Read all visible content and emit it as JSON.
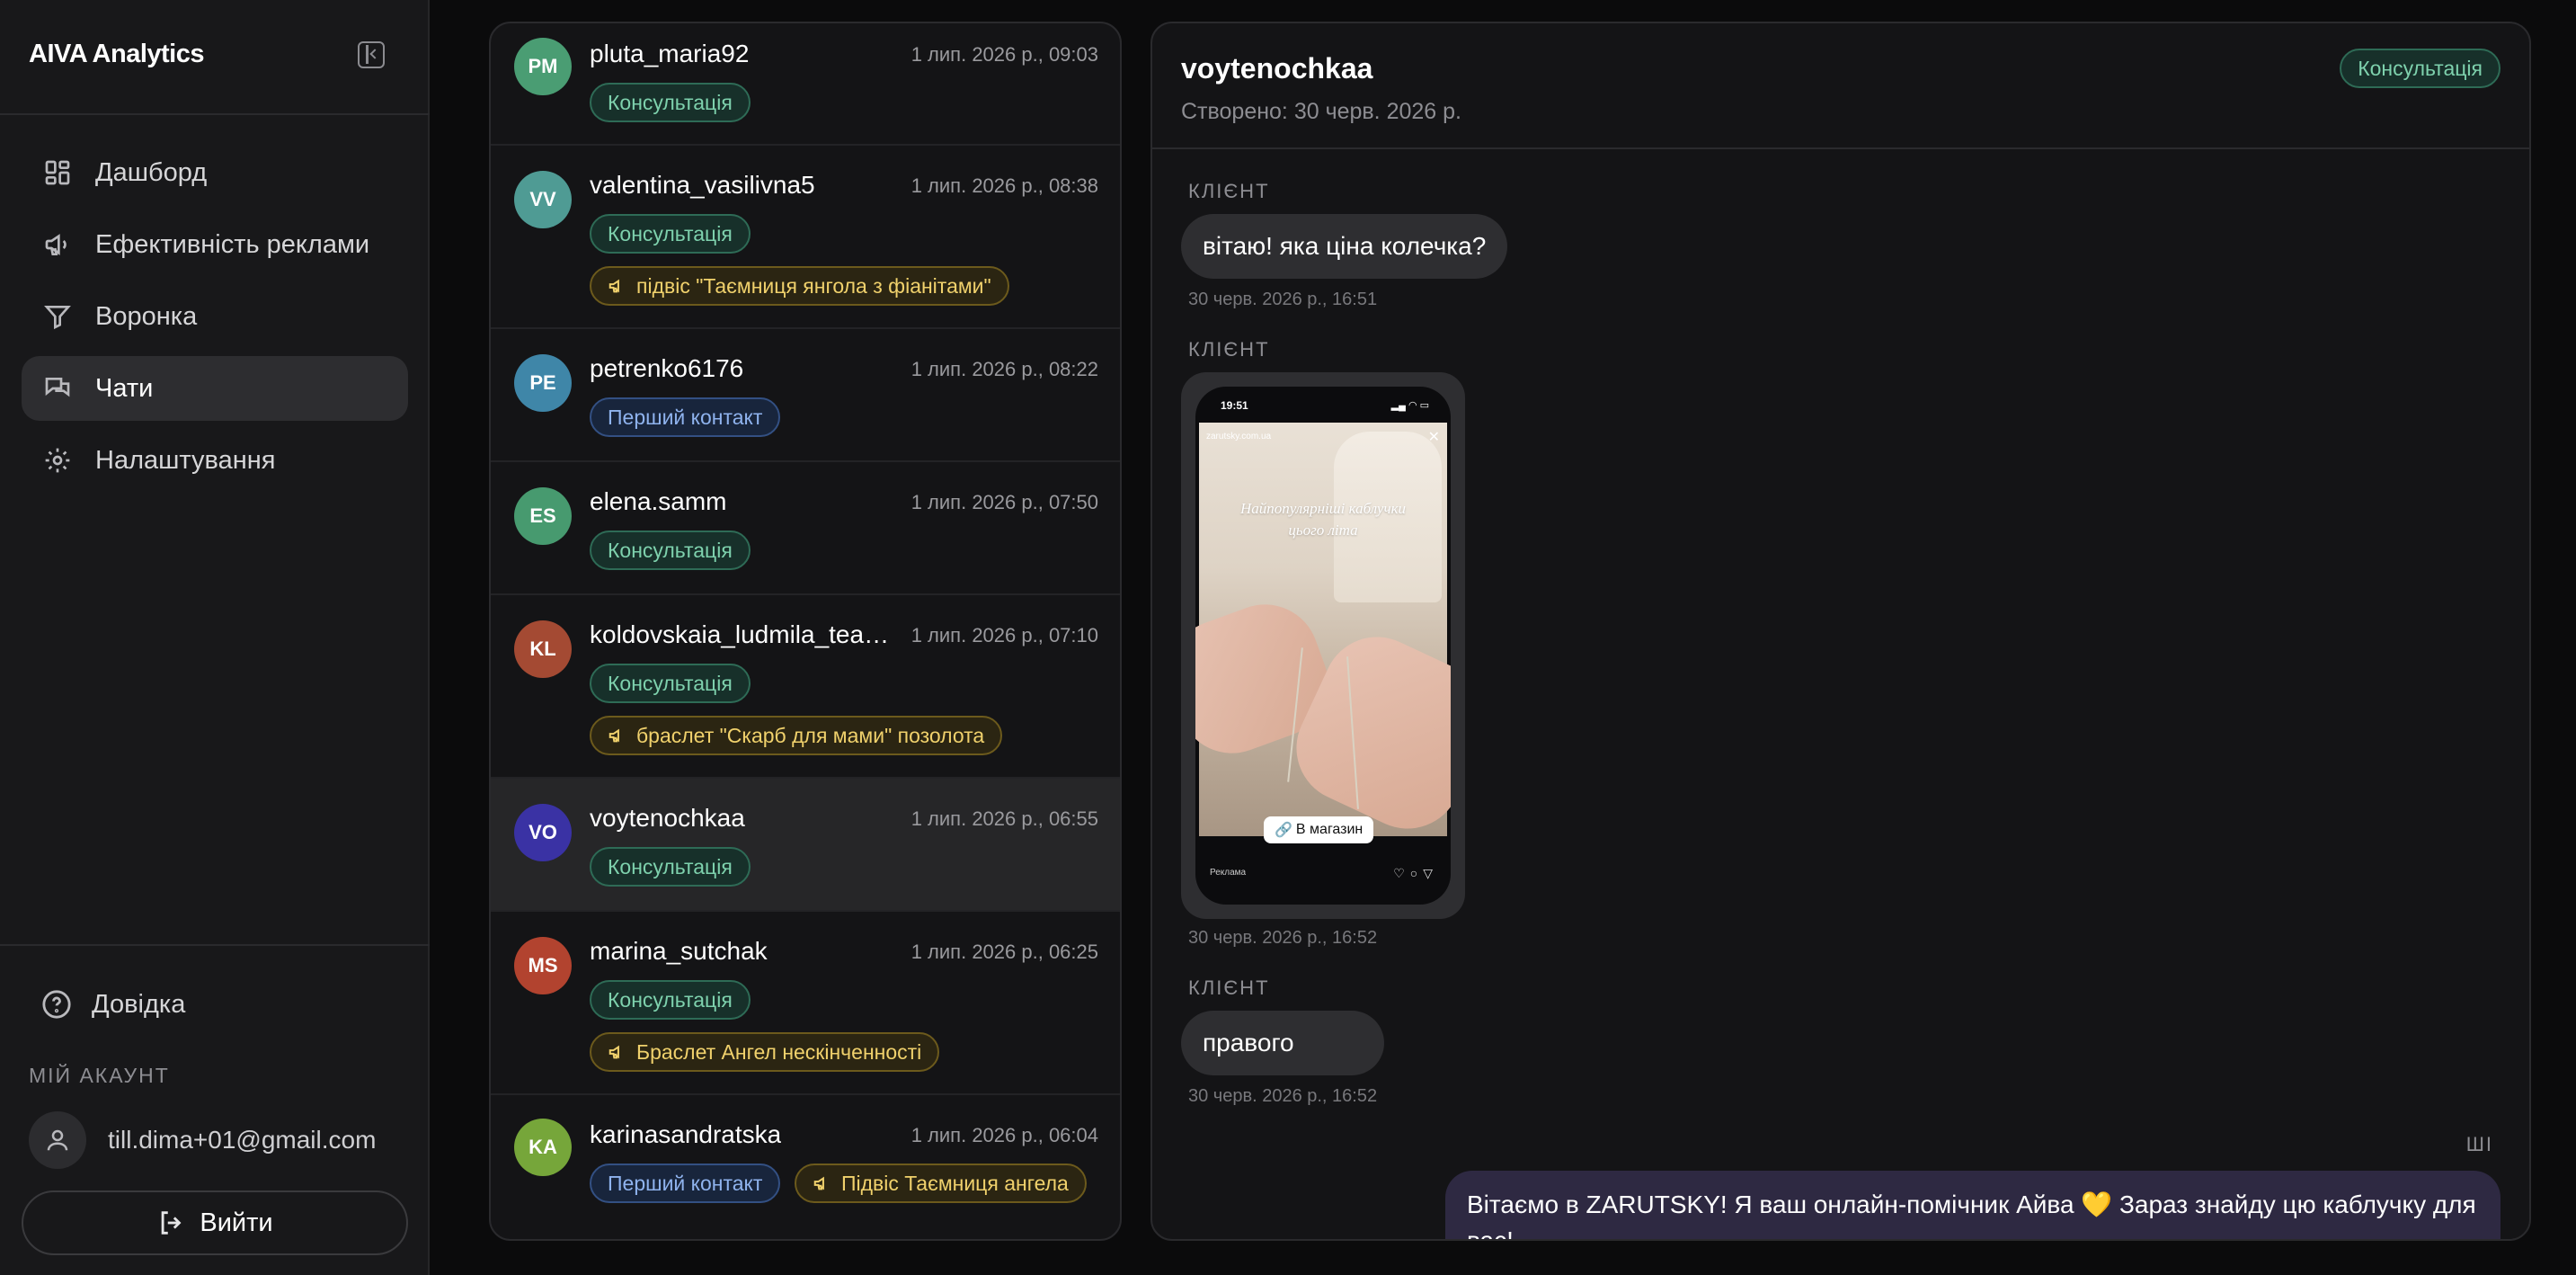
{
  "sidebar": {
    "brand": "AIVA Analytics",
    "nav": [
      {
        "label": "Дашборд",
        "icon": "dashboard-icon"
      },
      {
        "label": "Ефективність реклами",
        "icon": "megaphone-icon"
      },
      {
        "label": "Воронка",
        "icon": "funnel-icon"
      },
      {
        "label": "Чати",
        "icon": "chat-icon",
        "active": true
      },
      {
        "label": "Налаштування",
        "icon": "gear-icon"
      }
    ],
    "help_label": "Довідка",
    "account_label": "МІЙ АКАУНТ",
    "email": "till.dima+01@gmail.com",
    "logout_label": "Вийти"
  },
  "chats": [
    {
      "initials": "PM",
      "name": "pluta_maria92",
      "time": "1 лип. 2026 р., 09:03",
      "avatar_color": "#4a9d73",
      "tags": [
        {
          "kind": "green",
          "text": "Консультація"
        }
      ]
    },
    {
      "initials": "VV",
      "name": "valentina_vasilivna5",
      "time": "1 лип. 2026 р., 08:38",
      "avatar_color": "#4f9b94",
      "tags": [
        {
          "kind": "green",
          "text": "Консультація"
        },
        {
          "kind": "yellow",
          "text": "підвіс \"Таємниця янгола з фіанітами\""
        }
      ]
    },
    {
      "initials": "PE",
      "name": "petrenko6176",
      "time": "1 лип. 2026 р., 08:22",
      "avatar_color": "#3f86a8",
      "tags": [
        {
          "kind": "blue",
          "text": "Перший контакт"
        }
      ]
    },
    {
      "initials": "ES",
      "name": "elena.samm",
      "time": "1 лип. 2026 р., 07:50",
      "avatar_color": "#479a6f",
      "tags": [
        {
          "kind": "green",
          "text": "Консультація"
        }
      ]
    },
    {
      "initials": "KL",
      "name": "koldovskaia_ludmila_teac...",
      "time": "1 лип. 2026 р., 07:10",
      "avatar_color": "#a44a33",
      "tags": [
        {
          "kind": "green",
          "text": "Консультація"
        },
        {
          "kind": "yellow",
          "text": "браслет \"Скарб для мами\" позолота"
        }
      ]
    },
    {
      "initials": "VO",
      "name": "voytenochkaa",
      "time": "1 лип. 2026 р., 06:55",
      "avatar_color": "#3a32a4",
      "selected": true,
      "tags": [
        {
          "kind": "green",
          "text": "Консультація"
        }
      ]
    },
    {
      "initials": "MS",
      "name": "marina_sutchak",
      "time": "1 лип. 2026 р., 06:25",
      "avatar_color": "#b2432f",
      "tags": [
        {
          "kind": "green",
          "text": "Консультація"
        },
        {
          "kind": "yellow",
          "text": "Браслет Ангел нескінченності"
        }
      ]
    },
    {
      "initials": "KA",
      "name": "karinasandratska",
      "time": "1 лип. 2026 р., 06:04",
      "avatar_color": "#76a63a",
      "tags": [
        {
          "kind": "blue",
          "text": "Перший контакт"
        },
        {
          "kind": "yellow",
          "text": "Підвіс Таємниця ангела"
        }
      ]
    }
  ],
  "conversation": {
    "title": "voytenochkaa",
    "created": "Створено: 30 черв. 2026 р.",
    "tag": "Консультація",
    "messages": [
      {
        "role": "КЛІЄНТ",
        "text": "вітаю! яка ціна колечка?",
        "time": "30 черв. 2026 р., 16:51"
      },
      {
        "role": "КЛІЄНТ",
        "image": {
          "status_time": "19:51",
          "account": "zarutsky.com.ua",
          "caption_line1": "Найпопулярніші каблучки",
          "caption_line2": "цього літа",
          "shop_button": "В магазин",
          "ad_label": "Реклама"
        },
        "time": "30 черв. 2026 р., 16:52"
      },
      {
        "role": "КЛІЄНТ",
        "text": "правого",
        "time": "30 черв. 2026 р., 16:52"
      },
      {
        "role": "ШІ",
        "text": "Вітаємо в ZARUTSKY! Я ваш онлайн-помічник Айва 💛 Зараз знайду цю каблучку для вас!"
      }
    ]
  }
}
